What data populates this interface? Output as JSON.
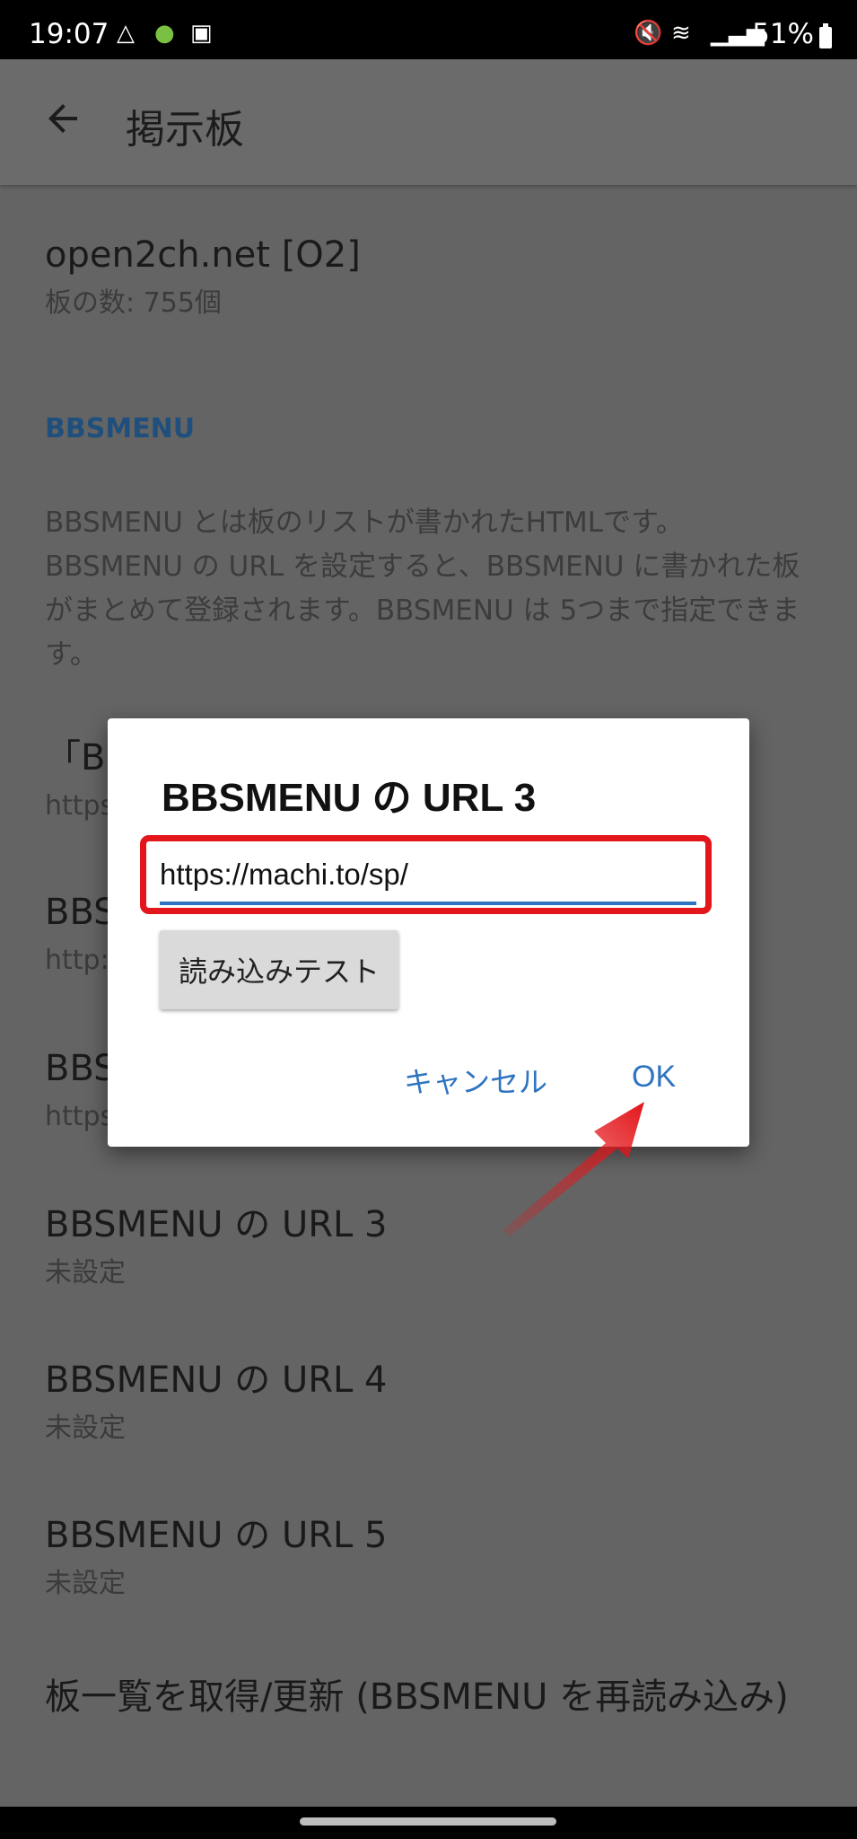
{
  "status_bar": {
    "time": "19:07",
    "battery": "51%"
  },
  "app_bar": {
    "title": "掲示板"
  },
  "site": {
    "title": "open2ch.net [O2]",
    "subtitle": "板の数: 755個"
  },
  "section_header": "BBSMENU",
  "description": "BBSMENU とは板のリストが書かれたHTMLです。BBSMENU の URL を設定すると、BBSMENU に書かれた板がまとめて登録されます。BBSMENU は 5つまで指定できます。",
  "hidden_items": [
    {
      "title": "「B",
      "subtitle": "https"
    },
    {
      "title": "BBS",
      "subtitle": "http:"
    },
    {
      "title": "BBS",
      "subtitle": "https"
    }
  ],
  "url_items": [
    {
      "title": "BBSMENU の URL 3",
      "subtitle": "未設定"
    },
    {
      "title": "BBSMENU の URL 4",
      "subtitle": "未設定"
    },
    {
      "title": "BBSMENU の URL 5",
      "subtitle": "未設定"
    }
  ],
  "refresh_item": {
    "title": "板一覧を取得/更新 (BBSMENU を再読み込み)"
  },
  "dialog": {
    "title": "BBSMENU の URL 3",
    "url_value": "https://machi.to/sp/",
    "test_button": "読み込みテスト",
    "cancel": "キャンセル",
    "ok": "OK"
  },
  "colors": {
    "accent": "#2e74c0",
    "highlight": "#e3161b",
    "section": "#1f4f7d"
  }
}
